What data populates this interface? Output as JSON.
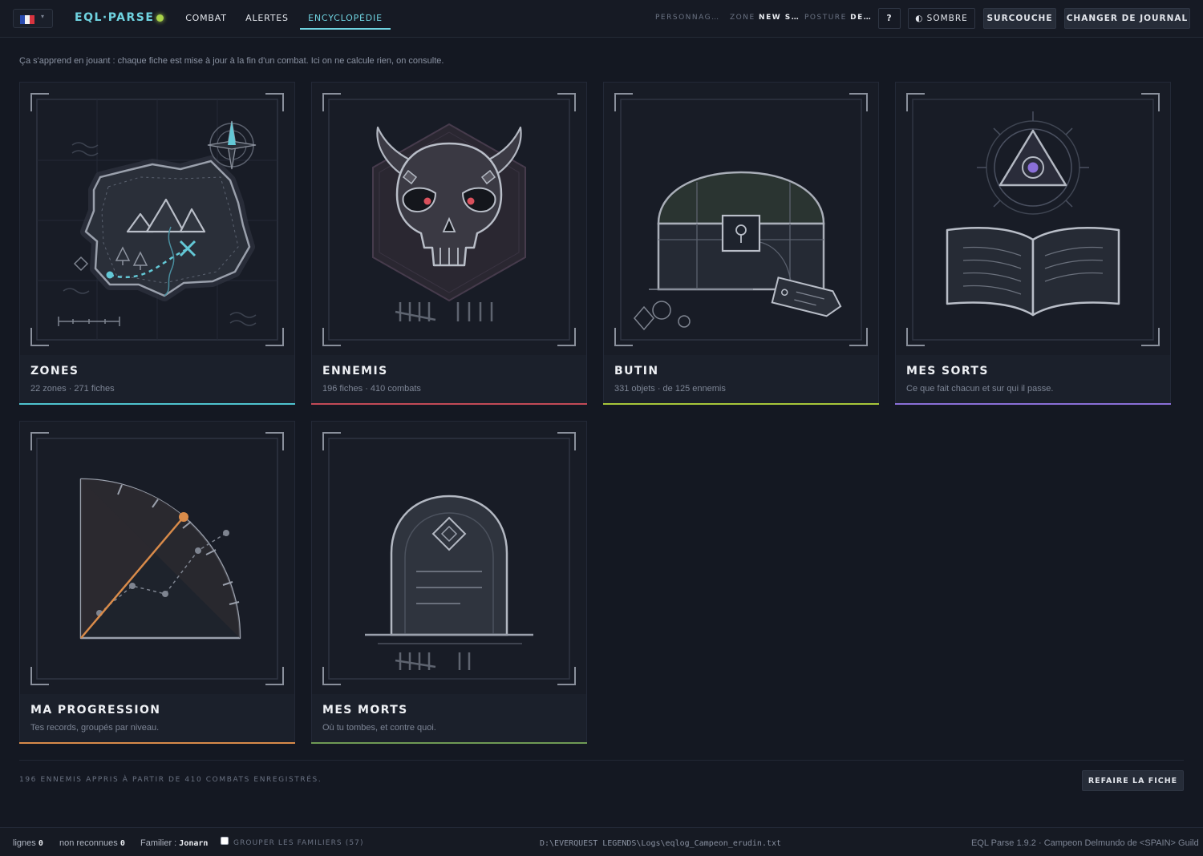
{
  "header": {
    "language": "FR",
    "brand": "EQL·PARSE",
    "tabs": [
      {
        "label": "COMBAT"
      },
      {
        "label": "ALERTES"
      },
      {
        "label": "ENCYCLOPÉDIE",
        "active": true
      }
    ],
    "status": {
      "character_label": "PERSONNAG…",
      "zone_label": "ZONE",
      "zone_value": "NEW S…",
      "posture_label": "POSTURE",
      "posture_value": "DE…"
    },
    "help_button": "?",
    "theme_button": "◐ SOMBRE",
    "overlay_button": "SURCOUCHE",
    "change_log_button": "CHANGER DE JOURNAL"
  },
  "intro_text": "Ça s'apprend en jouant : chaque fiche est mise à jour à la fin d'un combat. Ici on ne calcule rien, on consulte.",
  "cards": [
    {
      "title": "ZONES",
      "subtitle": "22 zones · 271 fiches",
      "accent": "#4fc3cf",
      "icon": "map-icon"
    },
    {
      "title": "ENNEMIS",
      "subtitle": "196 fiches · 410 combats",
      "accent": "#c24a57",
      "icon": "skull-icon"
    },
    {
      "title": "BUTIN",
      "subtitle": "331 objets · de 125 ennemis",
      "accent": "#a8c63a",
      "icon": "treasure-chest-icon"
    },
    {
      "title": "MES SORTS",
      "subtitle": "Ce que fait chacun et sur qui il passe.",
      "accent": "#8a6fd8",
      "icon": "spellbook-icon"
    },
    {
      "title": "MA PROGRESSION",
      "subtitle": "Tes records, groupés par niveau.",
      "accent": "#d98b4a",
      "icon": "progress-gauge-icon"
    },
    {
      "title": "MES MORTS",
      "subtitle": "Où tu tombes, et contre quoi.",
      "accent": "#6f9a55",
      "icon": "tombstone-icon"
    }
  ],
  "footer": {
    "stat_text": "196 ENNEMIS APPRIS À PARTIR DE 410 COMBATS ENREGISTRÉS.",
    "rebuild_button": "REFAIRE LA FICHE"
  },
  "statusbar": {
    "lines_label": "lignes",
    "lines_value": "0",
    "unrecognized_label": "non reconnues",
    "unrecognized_value": "0",
    "familiar_label": "Familier :",
    "familiar_value": "Jonarn",
    "group_familiars_label": "GROUPER LES FAMILIERS (57)",
    "group_familiars_checked": false,
    "log_path": "D:\\EVERQUEST LEGENDS\\Logs\\eqlog_Campeon_erudin.txt",
    "version_info": "EQL Parse 1.9.2 · Campeon Delmundo de <SPAIN> Guild"
  }
}
